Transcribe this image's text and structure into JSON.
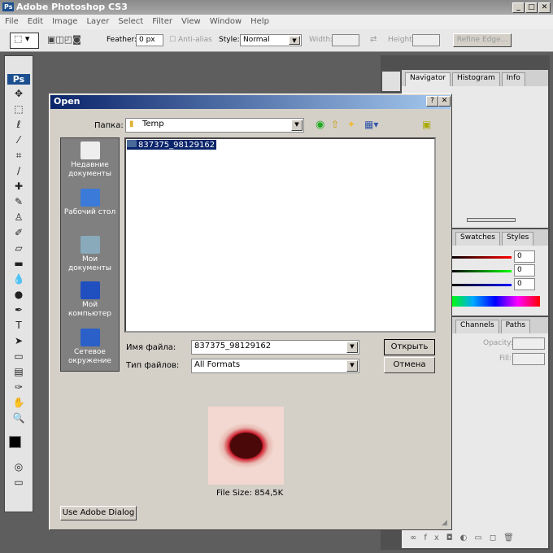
{
  "app": {
    "title": "Adobe Photoshop CS3",
    "logo": "Ps"
  },
  "menu": [
    "File",
    "Edit",
    "Image",
    "Layer",
    "Select",
    "Filter",
    "View",
    "Window",
    "Help"
  ],
  "options": {
    "feather_label": "Feather:",
    "feather_value": "0 px",
    "antialias_label": "Anti-alias",
    "style_label": "Style:",
    "style_value": "Normal",
    "width_label": "Width:",
    "height_label": "Height:",
    "refine_edge": "Refine Edge..."
  },
  "panels": {
    "tabs1": [
      "Navigator",
      "Histogram",
      "Info"
    ],
    "tabs2": [
      "Swatches",
      "Styles"
    ],
    "tabs3": [
      "Channels",
      "Paths"
    ],
    "color_values": [
      "0",
      "0",
      "0"
    ],
    "opacity_label": "Opacity:",
    "fill_label": "Fill:"
  },
  "dialog": {
    "title": "Open",
    "look_in_label": "Папка:",
    "look_in_value": "Temp",
    "places": [
      "Недавние документы",
      "Рабочий стол",
      "Мои документы",
      "Мой компьютер",
      "Сетевое окружение"
    ],
    "files": [
      "837375_98129162"
    ],
    "filename_label": "Имя файла:",
    "filename_value": "837375_98129162",
    "filetype_label": "Тип файлов:",
    "filetype_value": "All Formats",
    "open_button": "Открыть",
    "cancel_button": "Отмена",
    "file_size": "File Size: 854,5K",
    "adobe_dialog_button": "Use Adobe Dialog"
  }
}
